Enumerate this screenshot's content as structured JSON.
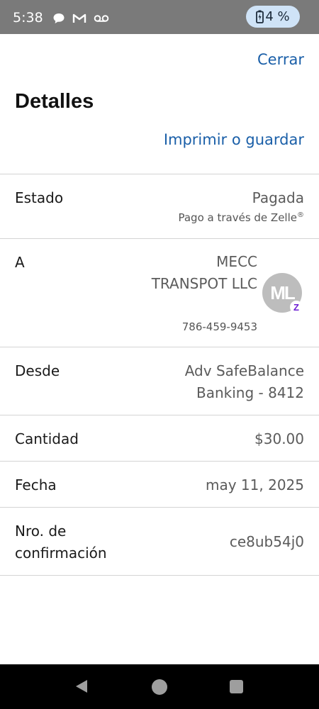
{
  "status_bar": {
    "time": "5:38",
    "icons": [
      "chat-icon",
      "gmail-icon",
      "voicemail-icon"
    ],
    "battery": "4 %",
    "battery_icon": "battery-charging-icon"
  },
  "header": {
    "close_label": "Cerrar",
    "title": "Detalles",
    "print_label": "Imprimir o guardar"
  },
  "details": {
    "status": {
      "label": "Estado",
      "value": "Pagada",
      "sub_text": "Pago a través de Zelle",
      "sub_mark": "®"
    },
    "to": {
      "label": "A",
      "name": "MECC TRANSPOT LLC",
      "phone": "786-459-9453",
      "avatar_initials": "ML",
      "badge": "Z"
    },
    "from": {
      "label": "Desde",
      "line1": "Adv SafeBalance",
      "line2": "Banking - 8412"
    },
    "amount": {
      "label": "Cantidad",
      "value": "$30.00"
    },
    "date": {
      "label": "Fecha",
      "value": "may 11, 2025"
    },
    "confirmation": {
      "label_line1": "Nro. de",
      "label_line2": "confirmación",
      "value": "ce8ub54j0"
    }
  },
  "colors": {
    "link": "#1a5fa8",
    "status_bar": "#7a7a7a",
    "zelle_purple": "#6d1ed4"
  }
}
